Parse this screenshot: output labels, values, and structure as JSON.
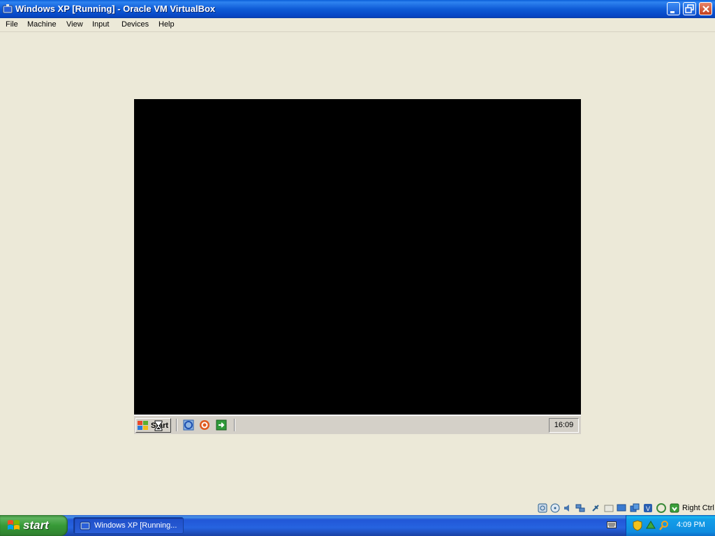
{
  "window": {
    "title": "Windows XP [Running] - Oracle VM VirtualBox"
  },
  "menu": [
    "File",
    "Machine",
    "View",
    "Input",
    "Devices",
    "Help"
  ],
  "guest": {
    "start_label": "Start",
    "clock": "16:09"
  },
  "statusbar": {
    "host_key": "Right Ctrl",
    "icons": [
      "hard-disk-icon",
      "optical-drive-icon",
      "audio-icon",
      "network-icon",
      "usb-icon",
      "shared-folders-icon",
      "display-icon",
      "video-capture-icon",
      "virtualization-icon",
      "mouse-integration-icon",
      "host-key-icon"
    ]
  },
  "taskbar": {
    "start_label": "start",
    "task_item": "Windows XP [Running...",
    "clock": "4:09 PM"
  },
  "colors": {
    "titlebar": "#0A5FD8",
    "desktop": "#ECE9D8",
    "vm_screen": "#000000",
    "taskbar": "#2663E0",
    "start_button": "#379A37",
    "tray": "#139EE9"
  }
}
